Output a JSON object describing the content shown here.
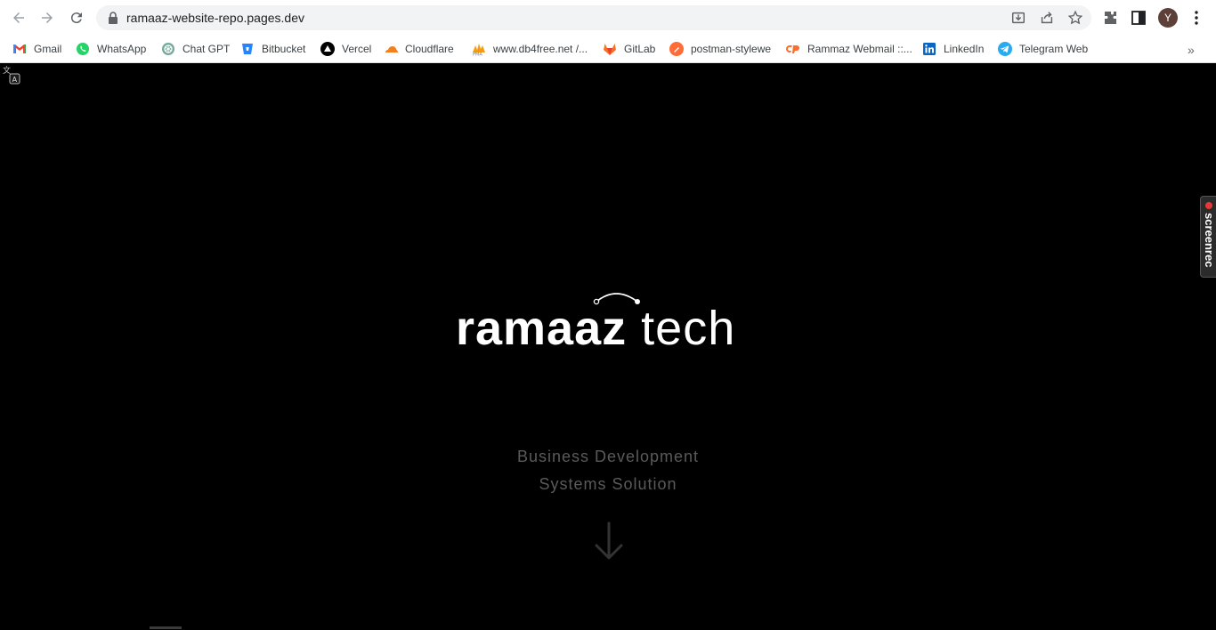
{
  "browser": {
    "url": "ramaaz-website-repo.pages.dev",
    "avatar_letter": "Y"
  },
  "bookmarks": [
    {
      "label": "Gmail",
      "icon": "gmail-icon",
      "color": "#ea4335"
    },
    {
      "label": "WhatsApp",
      "icon": "whatsapp-icon",
      "color": "#25d366"
    },
    {
      "label": "Chat GPT",
      "icon": "chatgpt-icon",
      "color": "#74aa9c"
    },
    {
      "label": "Bitbucket",
      "icon": "bitbucket-icon",
      "color": "#2684ff"
    },
    {
      "label": "Vercel",
      "icon": "vercel-icon",
      "color": "#000000"
    },
    {
      "label": "Cloudflare",
      "icon": "cloudflare-icon",
      "color": "#f38020"
    },
    {
      "label": "www.db4free.net /...",
      "icon": "phpmyadmin-icon",
      "color": "#f89c0e"
    },
    {
      "label": "GitLab",
      "icon": "gitlab-icon",
      "color": "#fc6d26"
    },
    {
      "label": "postman-stylewe",
      "icon": "postman-icon",
      "color": "#ff6c37"
    },
    {
      "label": "Rammaz Webmail ::...",
      "icon": "cpanel-icon",
      "color": "#ff6c2c"
    },
    {
      "label": "LinkedIn",
      "icon": "linkedin-icon",
      "color": "#0a66c2"
    },
    {
      "label": "Telegram Web",
      "icon": "telegram-icon",
      "color": "#2aabee"
    }
  ],
  "page": {
    "logo_bold": "ramaaz",
    "logo_light": "tech",
    "tagline_line1": "Business Development",
    "tagline_line2": "Systems Solution"
  },
  "extension": {
    "screenrec_label": "screenrec"
  },
  "colors": {
    "page_bg": "#000000",
    "tagline": "#5a5a5a",
    "logo": "#ffffff"
  }
}
